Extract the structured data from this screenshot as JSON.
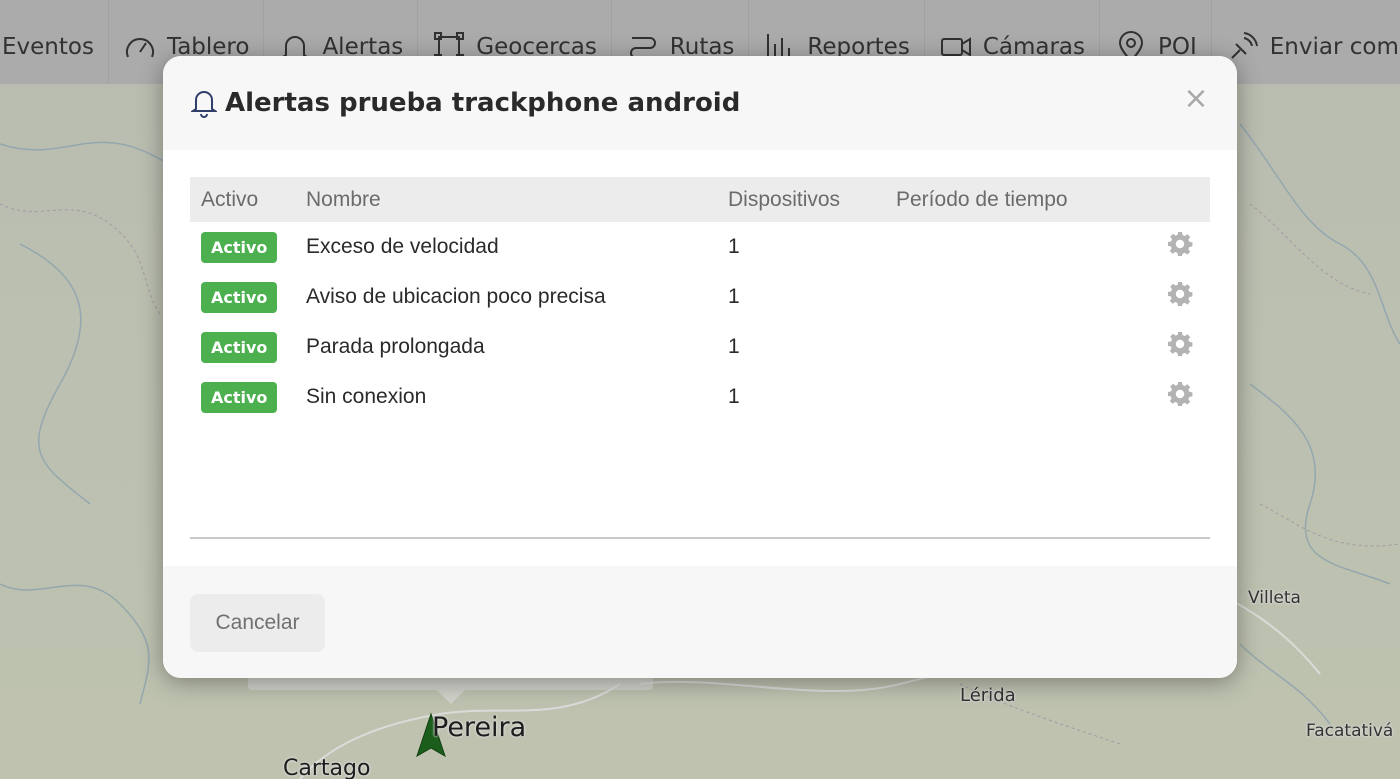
{
  "nav": {
    "items": [
      {
        "label": "Eventos",
        "icon": "none"
      },
      {
        "label": "Tablero",
        "icon": "gauge-icon"
      },
      {
        "label": "Alertas",
        "icon": "bell-icon"
      },
      {
        "label": "Geocercas",
        "icon": "geofence-icon"
      },
      {
        "label": "Rutas",
        "icon": "route-icon"
      },
      {
        "label": "Reportes",
        "icon": "bar-chart-icon"
      },
      {
        "label": "Cámaras",
        "icon": "video-camera-icon"
      },
      {
        "label": "POI",
        "icon": "map-pin-icon"
      },
      {
        "label": "Enviar comand",
        "icon": "send-signal-icon"
      }
    ]
  },
  "map": {
    "labels": {
      "pereira": "Pereira",
      "cartago": "Cartago",
      "lerida": "Lérida",
      "villeta": "Villeta",
      "facatativa": "Facatativá"
    }
  },
  "modal": {
    "title": "Alertas prueba trackphone android",
    "close_symbol": "×",
    "table": {
      "headers": {
        "active": "Activo",
        "name": "Nombre",
        "devices": "Dispositivos",
        "period": "Período de tiempo"
      },
      "rows": [
        {
          "status": "Activo",
          "name": "Exceso de velocidad",
          "devices": "1",
          "period": ""
        },
        {
          "status": "Activo",
          "name": "Aviso de ubicacion poco precisa",
          "devices": "1",
          "period": ""
        },
        {
          "status": "Activo",
          "name": "Parada prolongada",
          "devices": "1",
          "period": ""
        },
        {
          "status": "Activo",
          "name": "Sin conexion",
          "devices": "1",
          "period": ""
        }
      ]
    },
    "footer": {
      "cancel_label": "Cancelar"
    }
  },
  "colors": {
    "active_badge": "#4cb04f",
    "nav_background": "#c3c3c3",
    "marker": "#1f6b1f"
  }
}
